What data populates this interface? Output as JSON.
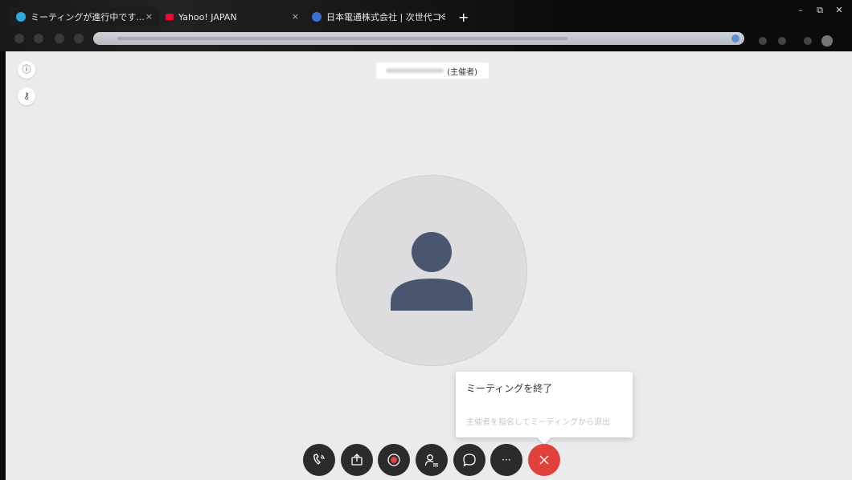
{
  "browser": {
    "tabs": [
      {
        "title": "ミーティングが進行中です...",
        "favicon_color": "#2fa8e0"
      },
      {
        "title": "Yahoo! JAPAN",
        "favicon_color": "#ff0033"
      },
      {
        "title": "日本電通株式会社 | 次世代コミ",
        "favicon_color": "#3b6fd4"
      }
    ],
    "new_tab": "+",
    "window_controls": [
      "–",
      "⧉",
      "✕"
    ]
  },
  "meeting": {
    "host_suffix": "(主催者)",
    "side_buttons": [
      {
        "icon": "info-icon",
        "glyph": "ⓘ"
      },
      {
        "icon": "key-icon",
        "glyph": "⚷"
      }
    ],
    "avatar": {
      "icon": "person-icon",
      "color": "#4a5670"
    }
  },
  "popup": {
    "end_meeting": "ミーティングを終了",
    "leave_meeting": "主催者を指名してミーティングから退出"
  },
  "controls": [
    {
      "name": "audio-button",
      "icon": "phone-audio-icon"
    },
    {
      "name": "share-button",
      "icon": "share-icon"
    },
    {
      "name": "record-button",
      "icon": "record-icon"
    },
    {
      "name": "participants-button",
      "icon": "participants-icon"
    },
    {
      "name": "chat-button",
      "icon": "chat-icon"
    },
    {
      "name": "more-button",
      "icon": "more-icon",
      "glyph": "···"
    },
    {
      "name": "end-call-button",
      "icon": "close-icon",
      "color": "#e0413a"
    }
  ]
}
